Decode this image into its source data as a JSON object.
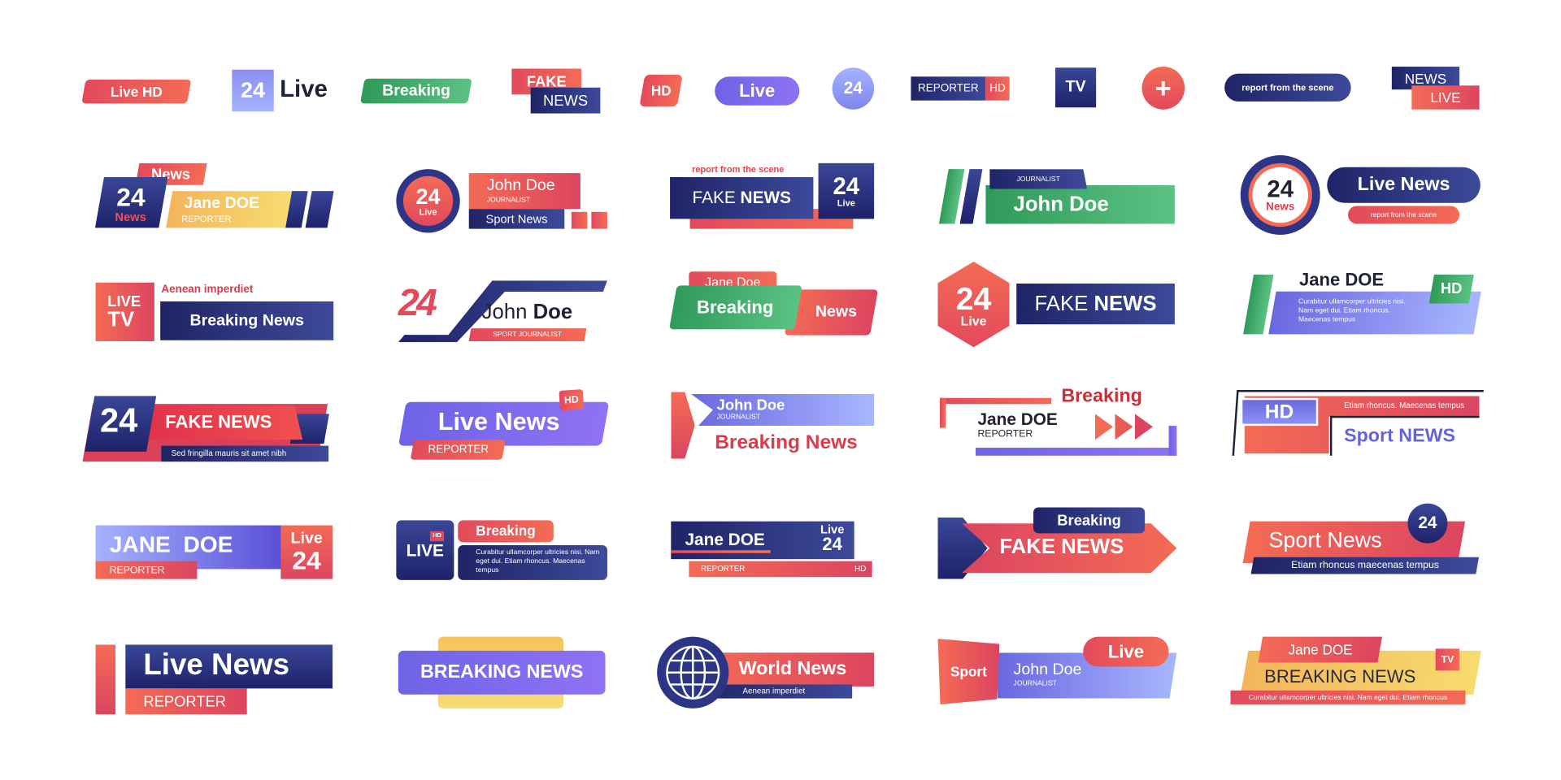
{
  "colors": {
    "navy": "#2a3282",
    "red": "#ee5a58",
    "green": "#3daa68",
    "purple": "#7b6bee",
    "lavender": "#9aa8ff",
    "yellow": "#f5d36a",
    "dark_text": "#1f2233"
  },
  "row1": {
    "live_hd": "Live HD",
    "badge_24": "24",
    "badge_live": "Live",
    "breaking": "Breaking",
    "fake": "FAKE",
    "news": "NEWS",
    "hd": "HD",
    "live_pill": "Live",
    "circle_24": "24",
    "reporter": "REPORTER",
    "reporter_hd": "HD",
    "tv": "TV",
    "plus_icon": "+",
    "report_scene": "report from the scene",
    "news2": "NEWS",
    "live2": "LIVE"
  },
  "row2": {
    "b1": {
      "tag": "News",
      "num": "24",
      "num_sub": "News",
      "name": "Jane DOE",
      "role": "REPORTER"
    },
    "b2": {
      "num": "24",
      "num_sub": "Live",
      "name": "John Doe",
      "role": "JOURNALIST",
      "sub": "Sport News"
    },
    "b3": {
      "kicker": "report from the scene",
      "title_light": "FAKE ",
      "title_bold": "NEWS",
      "num": "24",
      "num_sub": "Live"
    },
    "b4": {
      "role": "JOURNALIST",
      "name": "John Doe"
    },
    "b5": {
      "num": "24",
      "num_sub": "News",
      "title": "Live News",
      "sub": "report from the scene"
    }
  },
  "row3": {
    "b1": {
      "live": "LIVE",
      "tv": "TV",
      "kicker": "Aenean imperdiet",
      "title": "Breaking News"
    },
    "b2": {
      "num": "24",
      "name_light": "John ",
      "name_bold": "Doe",
      "role": "SPORT JOURNALIST"
    },
    "b3": {
      "name": "Jane Doe",
      "left": "Breaking",
      "right": "News"
    },
    "b4": {
      "num": "24",
      "num_sub": "Live",
      "title_light": "FAKE ",
      "title_bold": "NEWS"
    },
    "b5": {
      "name": "Jane DOE",
      "hd": "HD",
      "text": "Curabitur ullamcorper ultricies nisl. Nam eget dui. Etiam rhoncus. Maecenas tempus"
    }
  },
  "row4": {
    "b1": {
      "num": "24",
      "title": "FAKE NEWS",
      "sub": "Sed fringilla mauris sit amet nibh"
    },
    "b2": {
      "hd": "HD",
      "title": "Live News",
      "role": "REPORTER"
    },
    "b3": {
      "name": "John Doe",
      "role": "JOURNALIST",
      "title": "Breaking News"
    },
    "b4": {
      "kicker": "Breaking",
      "name": "Jane DOE",
      "role": "REPORTER"
    },
    "b5": {
      "hd": "HD",
      "kicker": "Etiam rhoncus. Maecenas tempus",
      "title": "Sport NEWS"
    }
  },
  "row5": {
    "b1": {
      "name": "JANE  DOE",
      "role": "REPORTER",
      "live": "Live",
      "num": "24"
    },
    "b2": {
      "hd": "HD",
      "live": "LIVE",
      "kicker": "Breaking",
      "text": "Curabitur ullamcorper ultricies nisi. Nam eget dui. Etiam rhoncus. Maecenas tempus"
    },
    "b3": {
      "name": "Jane DOE",
      "live": "Live",
      "num": "24",
      "role": "REPORTER",
      "hd": "HD"
    },
    "b4": {
      "kicker": "Breaking",
      "title": "FAKE NEWS"
    },
    "b5": {
      "title": "Sport News",
      "num": "24",
      "sub": "Etiam rhoncus maecenas tempus"
    }
  },
  "row6": {
    "b1": {
      "title": "Live News",
      "role": "REPORTER"
    },
    "b2": {
      "title": "BREAKING NEWS"
    },
    "b3": {
      "title": "World News",
      "sub": "Aenean imperdiet"
    },
    "b4": {
      "sport": "Sport",
      "name": "John Doe",
      "role": "JOURNALIST",
      "live": "Live"
    },
    "b5": {
      "name": "Jane DOE",
      "title": "BREAKING NEWS",
      "tv": "TV",
      "sub": "Curabitur ullamcorper ultricies nisi. Nam eget dui. Etiam rhoncus"
    }
  }
}
